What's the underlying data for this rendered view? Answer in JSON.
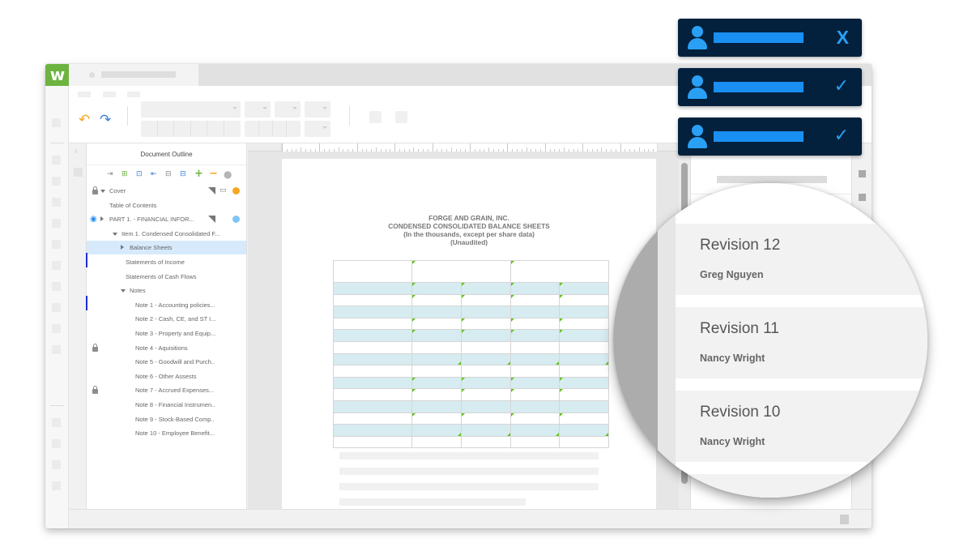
{
  "app": {
    "logo_text": "w",
    "brand_color": "#6cb43f"
  },
  "toolbar": {
    "undo_icon": "↶",
    "redo_icon": "↷"
  },
  "outline": {
    "title": "Document Outline",
    "tools": [
      {
        "icon": "indent-in-icon",
        "glyph": "⇥",
        "color": "#888"
      },
      {
        "icon": "add-section-icon",
        "glyph": "⊞",
        "color": "#6cb43f"
      },
      {
        "icon": "move-section-icon",
        "glyph": "⊡",
        "color": "#3b7dd8"
      },
      {
        "icon": "outdent-icon",
        "glyph": "⇤",
        "color": "#3b7dd8"
      },
      {
        "icon": "move-up-icon",
        "glyph": "⊟",
        "color": "#888"
      },
      {
        "icon": "move-down-icon",
        "glyph": "⊟",
        "color": "#3b7dd8"
      },
      {
        "icon": "plus-icon",
        "glyph": "+",
        "color": "#6cb43f"
      },
      {
        "icon": "minus-icon",
        "glyph": "−",
        "color": "#f5a623"
      },
      {
        "icon": "status-circle-icon",
        "glyph": "●",
        "color": "#b5b5b5"
      }
    ],
    "items": [
      {
        "label": "Cover",
        "level": 0,
        "locked": true,
        "expander": "down",
        "flag": true,
        "comment": true,
        "dot_color": "#f5a623"
      },
      {
        "label": "Table of Contents",
        "level": 0
      },
      {
        "label": "PART 1. - FINANCIAL INFOR...",
        "level": 0,
        "visible_icon": true,
        "expander": "right",
        "flag": true,
        "dot_color": "#7fc4f5"
      },
      {
        "label": "Item 1. Condensed Consolidated F...",
        "level": 1,
        "expander": "down"
      },
      {
        "label": "Balance Sheets",
        "level": 2,
        "expander": "right",
        "selected": true
      },
      {
        "label": "Statements of Income",
        "level": 2,
        "marker": true
      },
      {
        "label": "Statements of Cash Flows",
        "level": 2
      },
      {
        "label": "Notes",
        "level": 2,
        "expander": "down"
      },
      {
        "label": "Note 1 - Accounting policies...",
        "level": 3,
        "marker": true
      },
      {
        "label": "Note 2 - Cash, CE, and ST I...",
        "level": 3
      },
      {
        "label": "Note 3 - Property and Equip...",
        "level": 3
      },
      {
        "label": "Note 4 - Aquisitions",
        "level": 3,
        "locked": true
      },
      {
        "label": "Note 5 - Goodwill and Purch..",
        "level": 3
      },
      {
        "label": "Note 6 - Other Assests",
        "level": 3
      },
      {
        "label": "Note 7 - Accrued Expenses...",
        "level": 3,
        "locked": true
      },
      {
        "label": "Note 8 - Financial Instrumen..",
        "level": 3
      },
      {
        "label": "Note 9 - Stock-Based Comp..",
        "level": 3
      },
      {
        "label": "Note 10 - Employee Benefit...",
        "level": 3
      }
    ]
  },
  "document": {
    "company": "FORGE AND GRAIN, INC.",
    "title": "CONDENSED CONSOLIDATED BALANCE SHEETS",
    "subtitle": "(In the thousands, except per share data)",
    "note": "(Unaudited)",
    "table_row_count": 14
  },
  "notifications": [
    {
      "status": "rejected",
      "status_icon": "X",
      "avatar_icon": "user-icon"
    },
    {
      "status": "approved",
      "status_icon": "✓",
      "avatar_icon": "user-icon"
    },
    {
      "status": "approved",
      "status_icon": "✓",
      "avatar_icon": "user-icon"
    }
  ],
  "revisions": [
    {
      "title": "Revision 12",
      "author": "Greg Nguyen"
    },
    {
      "title": "Revision 11",
      "author": "Nancy Wright"
    },
    {
      "title": "Revision 10",
      "author": "Nancy Wright"
    }
  ],
  "colors": {
    "notification_bg": "#03213d",
    "notification_accent": "#2aa0f5",
    "selected_row": "#d6eafb",
    "table_shade": "#d7ecf1",
    "cell_marker": "#61c21e"
  }
}
